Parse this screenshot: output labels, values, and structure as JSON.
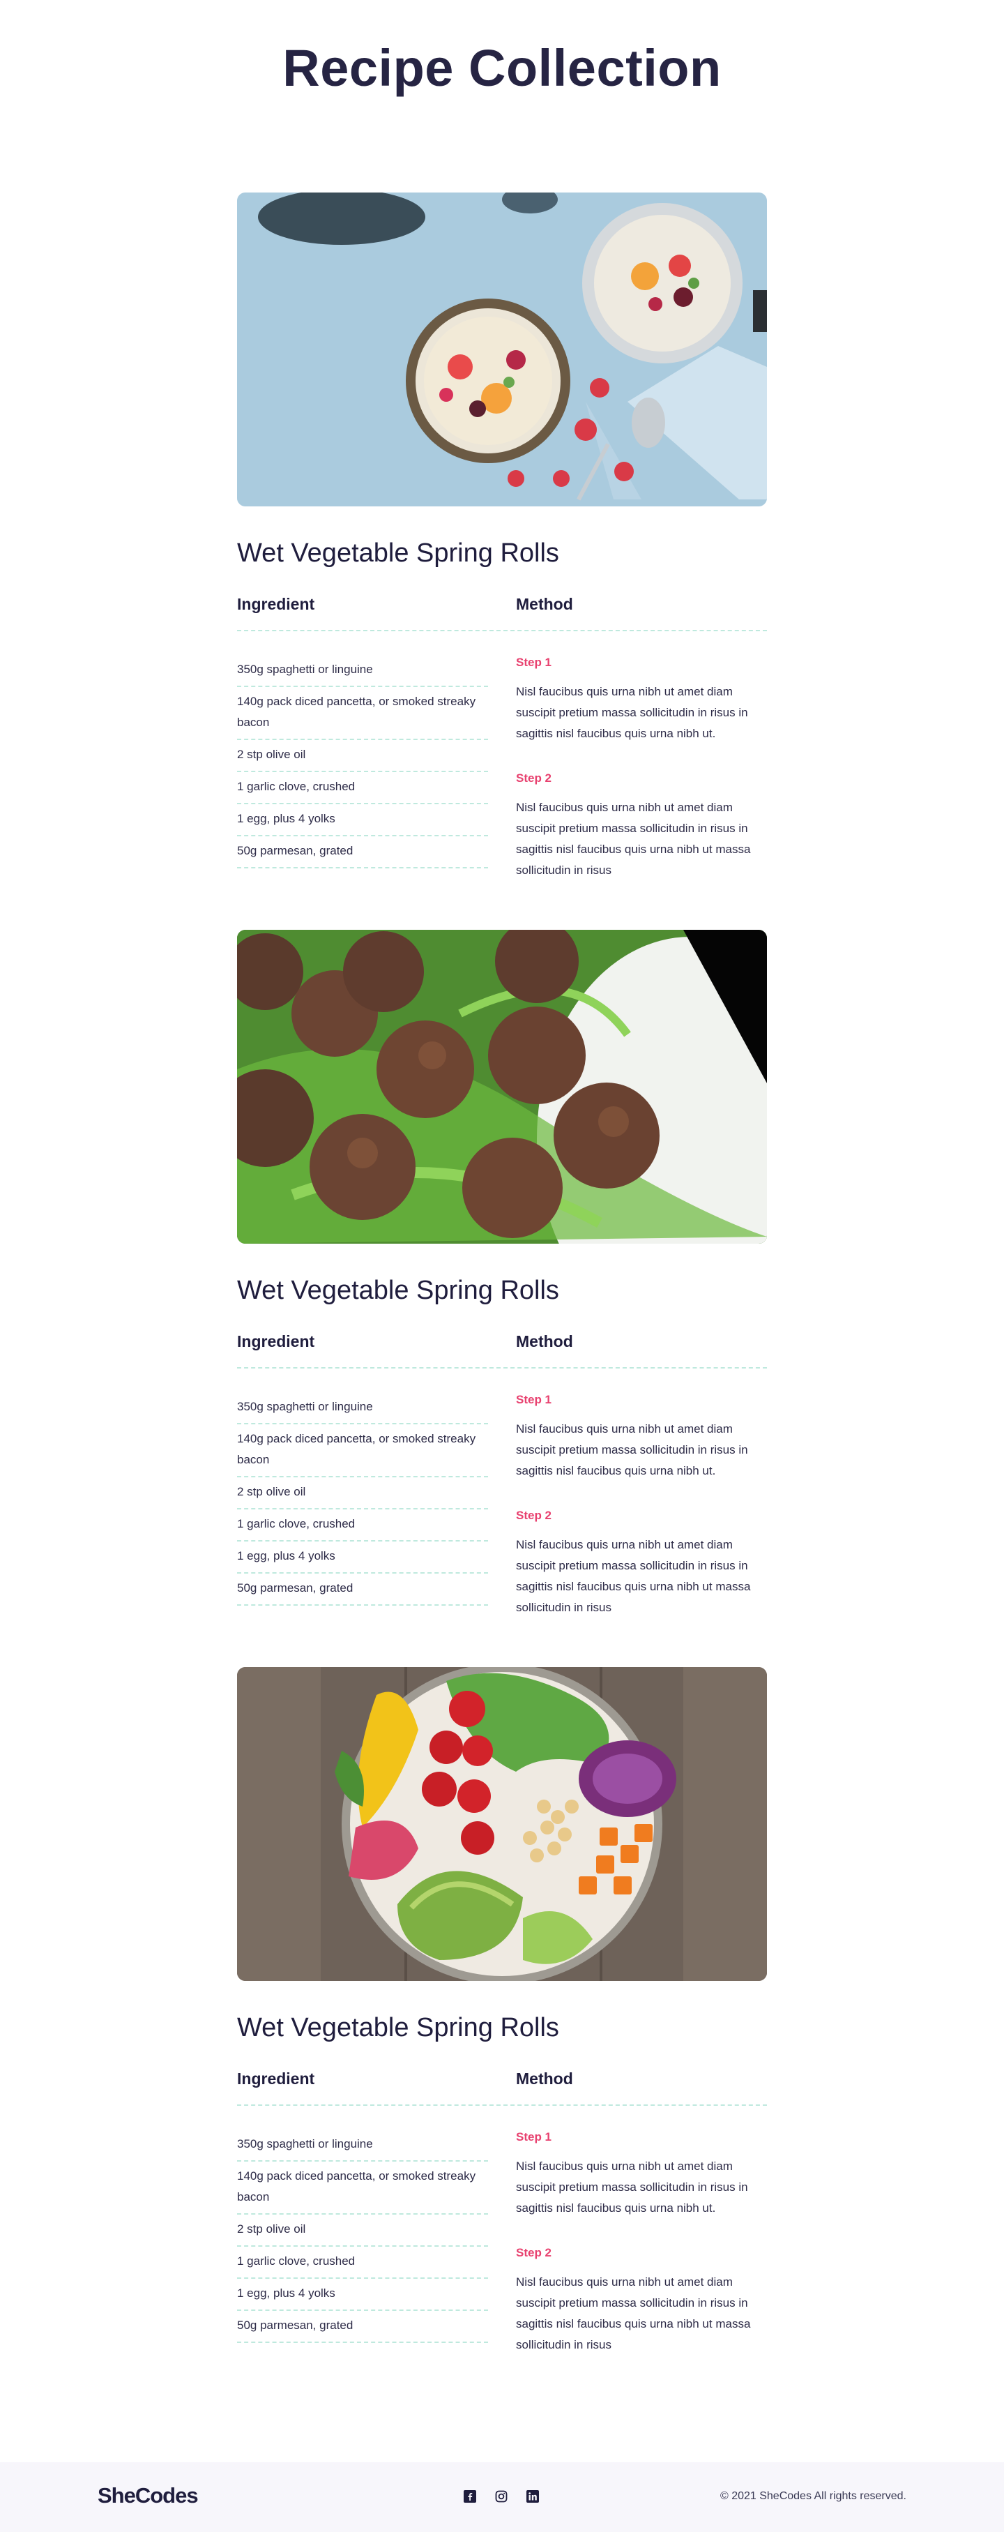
{
  "page": {
    "title": "Recipe Collection"
  },
  "recipes": [
    {
      "photo": "breakfast-bowls-photo",
      "title": "Wet Vegetable Spring Rolls",
      "ingredient_heading": "Ingredient",
      "method_heading": "Method",
      "ingredients": [
        "350g spaghetti or linguine",
        "140g pack diced pancetta, or smoked streaky bacon",
        "2 stp olive oil",
        "1 garlic clove, crushed",
        "1 egg, plus 4 yolks",
        "50g parmesan, grated"
      ],
      "steps": [
        {
          "label": "Step 1",
          "text": "Nisl faucibus quis urna nibh ut amet diam suscipit pretium massa sollicitudin in risus in sagittis nisl faucibus quis urna nibh ut."
        },
        {
          "label": "Step 2",
          "text": "Nisl faucibus quis urna nibh ut amet diam suscipit pretium massa sollicitudin in risus in sagittis nisl faucibus quis urna nibh ut massa sollicitudin in risus"
        }
      ]
    },
    {
      "photo": "meatballs-photo",
      "title": "Wet Vegetable Spring Rolls",
      "ingredient_heading": "Ingredient",
      "method_heading": "Method",
      "ingredients": [
        "350g spaghetti or linguine",
        "140g pack diced pancetta, or smoked streaky bacon",
        "2 stp olive oil",
        "1 garlic clove, crushed",
        "1 egg, plus 4 yolks",
        "50g parmesan, grated"
      ],
      "steps": [
        {
          "label": "Step 1",
          "text": "Nisl faucibus quis urna nibh ut amet diam suscipit pretium massa sollicitudin in risus in sagittis nisl faucibus quis urna nibh ut."
        },
        {
          "label": "Step 2",
          "text": "Nisl faucibus quis urna nibh ut amet diam suscipit pretium massa sollicitudin in risus in sagittis nisl faucibus quis urna nibh ut massa sollicitudin in risus"
        }
      ]
    },
    {
      "photo": "salad-bowl-photo",
      "title": "Wet Vegetable Spring Rolls",
      "ingredient_heading": "Ingredient",
      "method_heading": "Method",
      "ingredients": [
        "350g spaghetti or linguine",
        "140g pack diced pancetta, or smoked streaky bacon",
        "2 stp olive oil",
        "1 garlic clove, crushed",
        "1 egg, plus 4 yolks",
        "50g parmesan, grated"
      ],
      "steps": [
        {
          "label": "Step 1",
          "text": "Nisl faucibus quis urna nibh ut amet diam suscipit pretium massa sollicitudin in risus in sagittis nisl faucibus quis urna nibh ut."
        },
        {
          "label": "Step 2",
          "text": "Nisl faucibus quis urna nibh ut amet diam suscipit pretium massa sollicitudin in risus in sagittis nisl faucibus quis urna nibh ut massa sollicitudin in risus"
        }
      ]
    }
  ],
  "footer": {
    "logo": "SheCodes",
    "social": [
      "facebook-icon",
      "instagram-icon",
      "linkedin-icon"
    ],
    "copyright": "© 2021 SheCodes All rights reserved."
  },
  "colors": {
    "heading": "#262443",
    "step_accent": "#e8416f",
    "divider": "#bfe9de",
    "footer_bg": "#f7f6fb"
  }
}
